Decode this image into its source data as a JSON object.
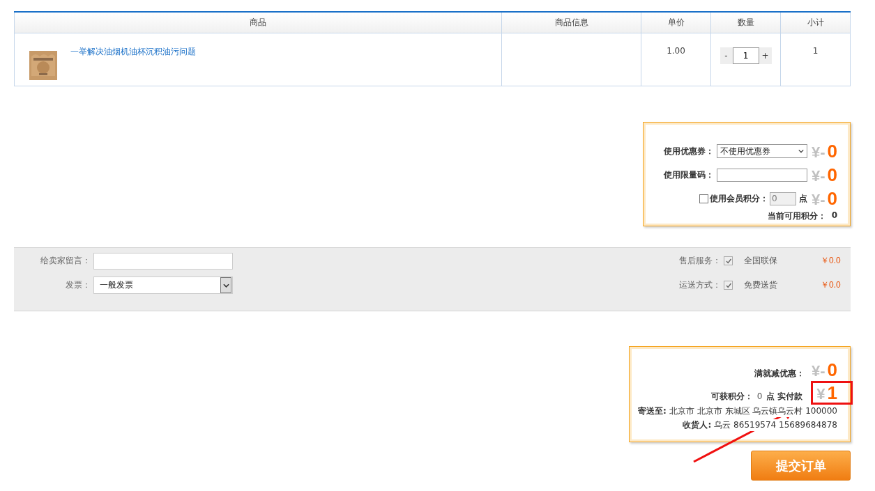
{
  "cart_table": {
    "columns": [
      "商品",
      "商品信息",
      "单价",
      "数量",
      "小计"
    ],
    "rows": [
      {
        "name": "一举解决油烟机油杯沉积油污问题",
        "unit_price": "1.00",
        "quantity": {
          "minus": "-",
          "value": "1",
          "plus": "+"
        },
        "subtotal": "1"
      }
    ]
  },
  "discount_panel": {
    "rows": [
      {
        "kind": "select",
        "label": "使用优惠券：",
        "value": "不使用优惠券",
        "currency": "¥-",
        "amount": "0"
      },
      {
        "kind": "input",
        "label": "使用限量码：",
        "currency": "¥-",
        "amount": "0"
      },
      {
        "kind": "points",
        "checked": false,
        "label": "使用会员积分：",
        "value": "0",
        "disabled": true,
        "unit": "点",
        "currency": "¥-",
        "amount": "0"
      }
    ],
    "available_points": {
      "label": "当前可用积分：",
      "value": "0"
    }
  },
  "order_options": {
    "left": [
      {
        "kind": "input",
        "label": "给卖家留言："
      },
      {
        "kind": "select",
        "label": "发票：",
        "value": "一般发票"
      }
    ],
    "right": [
      {
        "label": "售后服务：",
        "checked": true,
        "disabled": true,
        "option": "全国联保",
        "price": "￥0.0"
      },
      {
        "label": "运送方式：",
        "checked": true,
        "disabled": true,
        "option": "免费送货",
        "price": "￥0.0"
      }
    ]
  },
  "summary_panel": {
    "full_reduction": {
      "label": "满就减优惠：",
      "currency": "¥-",
      "amount": "0"
    },
    "points_earned": {
      "label": "可获积分：",
      "value": "0",
      "unit": "点"
    },
    "pay": {
      "label": "实付款",
      "currency": "¥",
      "amount": "1",
      "highlighted": true
    },
    "ship_to": {
      "label": "寄送至:",
      "value": "北京市 北京市 东城区 乌云镇乌云村 100000"
    },
    "receiver": {
      "label": "收货人:",
      "value": "乌云 86519574 15689684878"
    }
  },
  "submit_button": "提交订单",
  "annotation_arrow": true
}
